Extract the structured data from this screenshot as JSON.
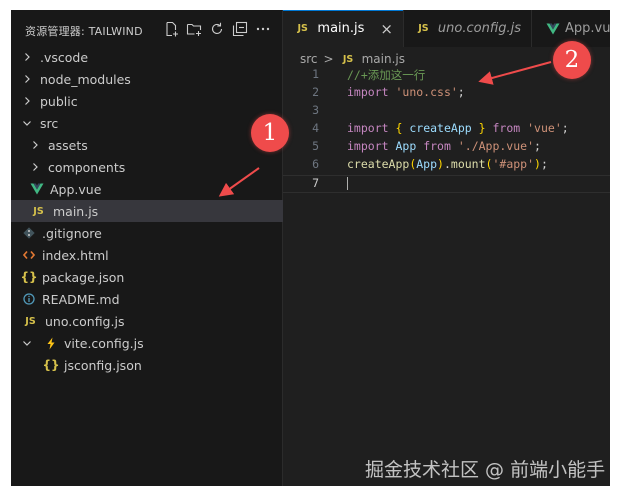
{
  "explorer": {
    "title": "资源管理器: TAILWIND",
    "actions": [
      {
        "name": "new-file-icon"
      },
      {
        "name": "new-folder-icon"
      },
      {
        "name": "refresh-icon"
      },
      {
        "name": "collapse-all-icon"
      },
      {
        "name": "more-actions-icon"
      }
    ],
    "items": [
      {
        "label": ".vscode",
        "kind": "folder",
        "expanded": false,
        "depth": 0
      },
      {
        "label": "node_modules",
        "kind": "folder",
        "expanded": false,
        "depth": 0
      },
      {
        "label": "public",
        "kind": "folder",
        "expanded": false,
        "depth": 0
      },
      {
        "label": "src",
        "kind": "folder",
        "expanded": true,
        "depth": 0
      },
      {
        "label": "assets",
        "kind": "folder",
        "expanded": false,
        "depth": 1
      },
      {
        "label": "components",
        "kind": "folder",
        "expanded": false,
        "depth": 1
      },
      {
        "label": "App.vue",
        "kind": "vue",
        "depth": 1
      },
      {
        "label": "main.js",
        "kind": "js",
        "depth": 1,
        "selected": true
      },
      {
        "label": ".gitignore",
        "kind": "git",
        "depth": 0
      },
      {
        "label": "index.html",
        "kind": "html",
        "depth": 0
      },
      {
        "label": "package.json",
        "kind": "json",
        "depth": 0
      },
      {
        "label": "README.md",
        "kind": "info",
        "depth": 0
      },
      {
        "label": "uno.config.js",
        "kind": "js",
        "depth": 0
      },
      {
        "label": "vite.config.js",
        "kind": "vite",
        "expanded": true,
        "depth": 0
      },
      {
        "label": "jsconfig.json",
        "kind": "json",
        "depth": 1
      }
    ]
  },
  "tabs": [
    {
      "label": "main.js",
      "icon": "JS",
      "active": true,
      "close": "×"
    },
    {
      "label": "uno.config.js",
      "icon": "JS",
      "italic": true
    },
    {
      "label": "App.vue",
      "icon": "vue"
    }
  ],
  "breadcrumb": {
    "folder": "src",
    "separator": ">",
    "file_icon": "JS",
    "file": "main.js"
  },
  "code": {
    "lines": [
      {
        "n": "1",
        "tokens": [
          [
            "cmt",
            "//+添加这一行"
          ]
        ]
      },
      {
        "n": "2",
        "tokens": [
          [
            "kw",
            "import"
          ],
          [
            "punc",
            " "
          ],
          [
            "str",
            "'uno.css'"
          ],
          [
            "punc",
            ";"
          ]
        ]
      },
      {
        "n": "3",
        "tokens": []
      },
      {
        "n": "4",
        "tokens": [
          [
            "kw",
            "import"
          ],
          [
            "punc",
            " "
          ],
          [
            "brk",
            "{"
          ],
          [
            "punc",
            " "
          ],
          [
            "var",
            "createApp"
          ],
          [
            "punc",
            " "
          ],
          [
            "brk",
            "}"
          ],
          [
            "punc",
            " "
          ],
          [
            "kw",
            "from"
          ],
          [
            "punc",
            " "
          ],
          [
            "str",
            "'vue'"
          ],
          [
            "punc",
            ";"
          ]
        ]
      },
      {
        "n": "5",
        "tokens": [
          [
            "kw",
            "import"
          ],
          [
            "punc",
            " "
          ],
          [
            "var",
            "App"
          ],
          [
            "punc",
            " "
          ],
          [
            "kw",
            "from"
          ],
          [
            "punc",
            " "
          ],
          [
            "str",
            "'./App.vue'"
          ],
          [
            "punc",
            ";"
          ]
        ]
      },
      {
        "n": "6",
        "tokens": [
          [
            "fn",
            "createApp"
          ],
          [
            "brk",
            "("
          ],
          [
            "var",
            "App"
          ],
          [
            "brk",
            ")"
          ],
          [
            "punc",
            "."
          ],
          [
            "fn",
            "mount"
          ],
          [
            "brk",
            "("
          ],
          [
            "str",
            "'#app'"
          ],
          [
            "brk",
            ")"
          ],
          [
            "punc",
            ";"
          ]
        ]
      },
      {
        "n": "7",
        "tokens": [],
        "current": true
      }
    ]
  },
  "annotations": [
    {
      "label": "1"
    },
    {
      "label": "2"
    }
  ],
  "colors": {
    "annotation": "#ef4b4b",
    "editor_bg": "#1f1f1f",
    "sidebar_bg": "#181818",
    "js_icon": "#d6c14b",
    "vue_icon": "#41b883"
  },
  "watermark": "掘金技术社区 @ 前端小能手"
}
